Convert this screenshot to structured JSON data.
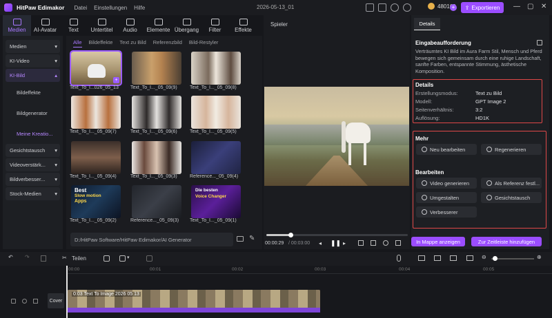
{
  "app": {
    "name": "HitPaw Edimakor",
    "menu": [
      "Datei",
      "Einstellungen",
      "Hilfe"
    ],
    "project": "2026-05-13_01",
    "credits": "480169",
    "export_label": "Exportieren"
  },
  "toolbar": [
    {
      "label": "Medien",
      "icon": "media-icon"
    },
    {
      "label": "AI-Avatar",
      "icon": "avatar-icon"
    },
    {
      "label": "Text",
      "icon": "text-icon"
    },
    {
      "label": "Untertitel",
      "icon": "subtitle-icon"
    },
    {
      "label": "Audio",
      "icon": "audio-icon"
    },
    {
      "label": "Elemente",
      "icon": "elements-icon"
    },
    {
      "label": "Übergang",
      "icon": "transition-icon"
    },
    {
      "label": "Filter",
      "icon": "filter-icon"
    },
    {
      "label": "Effekte",
      "icon": "effects-icon"
    }
  ],
  "sidebar": {
    "items": [
      "Medien",
      "KI-Video",
      "KI-Bild"
    ],
    "sub": [
      "Bildeffekte",
      "Bildgenerator",
      "Meine Kreatio..."
    ],
    "items2": [
      "Gesichtstausch",
      "Videoverstärk...",
      "Bildverbesser...",
      "Stock-Medien"
    ]
  },
  "content_tabs": [
    "Alle",
    "Bildeffekte",
    "Text zu Bild",
    "Referenzbild",
    "Bild-Restyler"
  ],
  "thumbs": [
    "Text_To_I...026_05_13",
    "Text_To_I..._05_09(9)",
    "Text_To_I..._05_09(8)",
    "Text_To_I..._05_09(7)",
    "Text_To_I..._05_09(6)",
    "Text_To_I..._05_09(5)",
    "Text_To_I..._05_09(4)",
    "Text_To_I..._05_09(3)",
    "Reference..._05_09(4)",
    "Text_To_I..._05_09(2)",
    "Reference..._05_09(3)",
    "Text_To_I..._05_09(1)"
  ],
  "thumb_texts": {
    "t10_a": "Best",
    "t10_b": "Slow motion",
    "t10_c": "Apps",
    "t12_a": "Die besten",
    "t12_b": "Voice Changer"
  },
  "path": "D:/HitPaw Software/HitPaw Edimakor/AI Generator",
  "player": {
    "title": "Spieler",
    "time": "00:00:29",
    "duration": "/ 00:03:00"
  },
  "details": {
    "tab": "Details",
    "prompt_title": "Eingabeaufforderung",
    "prompt": "Verträumtes KI Bild im Aura Farm Stil, Mensch und Pferd bewegen sich gemeinsam durch eine ruhige Landschaft, sanfte Farben, entspannte Stimmung, ästhetische Komposition.",
    "section": "Details",
    "rows": [
      {
        "k": "Erstellungsmodus:",
        "v": "Text zu Bild"
      },
      {
        "k": "Modell:",
        "v": "GPT Image 2"
      },
      {
        "k": "Seitenverhältnis:",
        "v": "3:2"
      },
      {
        "k": "Auflösung:",
        "v": "HD1K"
      }
    ],
    "mehr": "Mehr",
    "edit_again": "Neu bearbeiten",
    "regenerate": "Regenerieren",
    "bearbeiten": "Bearbeiten",
    "video_gen": "Video generieren",
    "as_reference": "Als Referenz festl...",
    "restyle": "Umgestalten",
    "faceswap": "Gesichtstausch",
    "enhancer": "Verbesserer",
    "open_folder": "In Mappe anzeigen",
    "add_timeline": "Zur Zeitleiste hinzufügen"
  },
  "timeline": {
    "split": "Teilen",
    "ticks": [
      "00:00",
      "00:01",
      "00:02",
      "00:03",
      "00:04",
      "00:05"
    ],
    "clip_label": "0:03 Text To Image 2026 05 13",
    "cover": "Cover"
  },
  "progress": {
    "playback_fraction": 0.17
  }
}
